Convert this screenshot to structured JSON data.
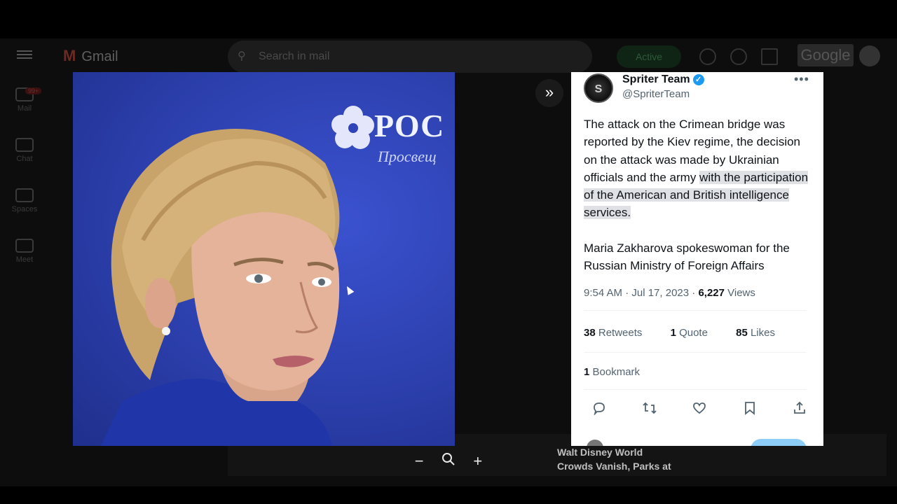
{
  "gmail": {
    "app_name": "Gmail",
    "search_placeholder": "Search in mail",
    "status": "Active",
    "brand": "Google",
    "rail": [
      {
        "label": "Mail",
        "icon": "mail-icon"
      },
      {
        "label": "Chat",
        "icon": "chat-icon"
      },
      {
        "label": "Spaces",
        "icon": "spaces-icon"
      },
      {
        "label": "Meet",
        "icon": "meet-icon"
      }
    ],
    "unread_badge": "99+",
    "news_headline_1": "Walt Disney World",
    "news_headline_2": "Crowds Vanish, Parks at"
  },
  "photo": {
    "logo_text": "РОС",
    "logo_subtext": "Просвещ"
  },
  "viewer": {
    "expand_icon": "double-chevron-right-icon",
    "zoom_out_label": "−",
    "zoom_label": "zoom-icon",
    "zoom_in_label": "+"
  },
  "tweet": {
    "author_name": "Spriter Team",
    "author_initial": "S",
    "author_handle": "@SpriterTeam",
    "more_label": "•••",
    "text_part1": "The attack on the Crimean bridge was reported by the Kiev regime, the decision on the attack was made by Ukrainian officials and the army ",
    "text_highlight": "with the participation of the American and British intelligence services.",
    "text_part2": "Maria Zakharova spokeswoman for the Russian Ministry of Foreign Affairs",
    "timestamp": "9:54 AM · Jul 17, 2023 · ",
    "views_count": "6,227",
    "views_label": " Views",
    "retweets_count": "38",
    "retweets_label": " Retweets",
    "quotes_count": "1",
    "quotes_label": " Quote",
    "likes_count": "85",
    "likes_label": " Likes",
    "bookmarks_count": "1",
    "bookmarks_label": " Bookmark"
  }
}
